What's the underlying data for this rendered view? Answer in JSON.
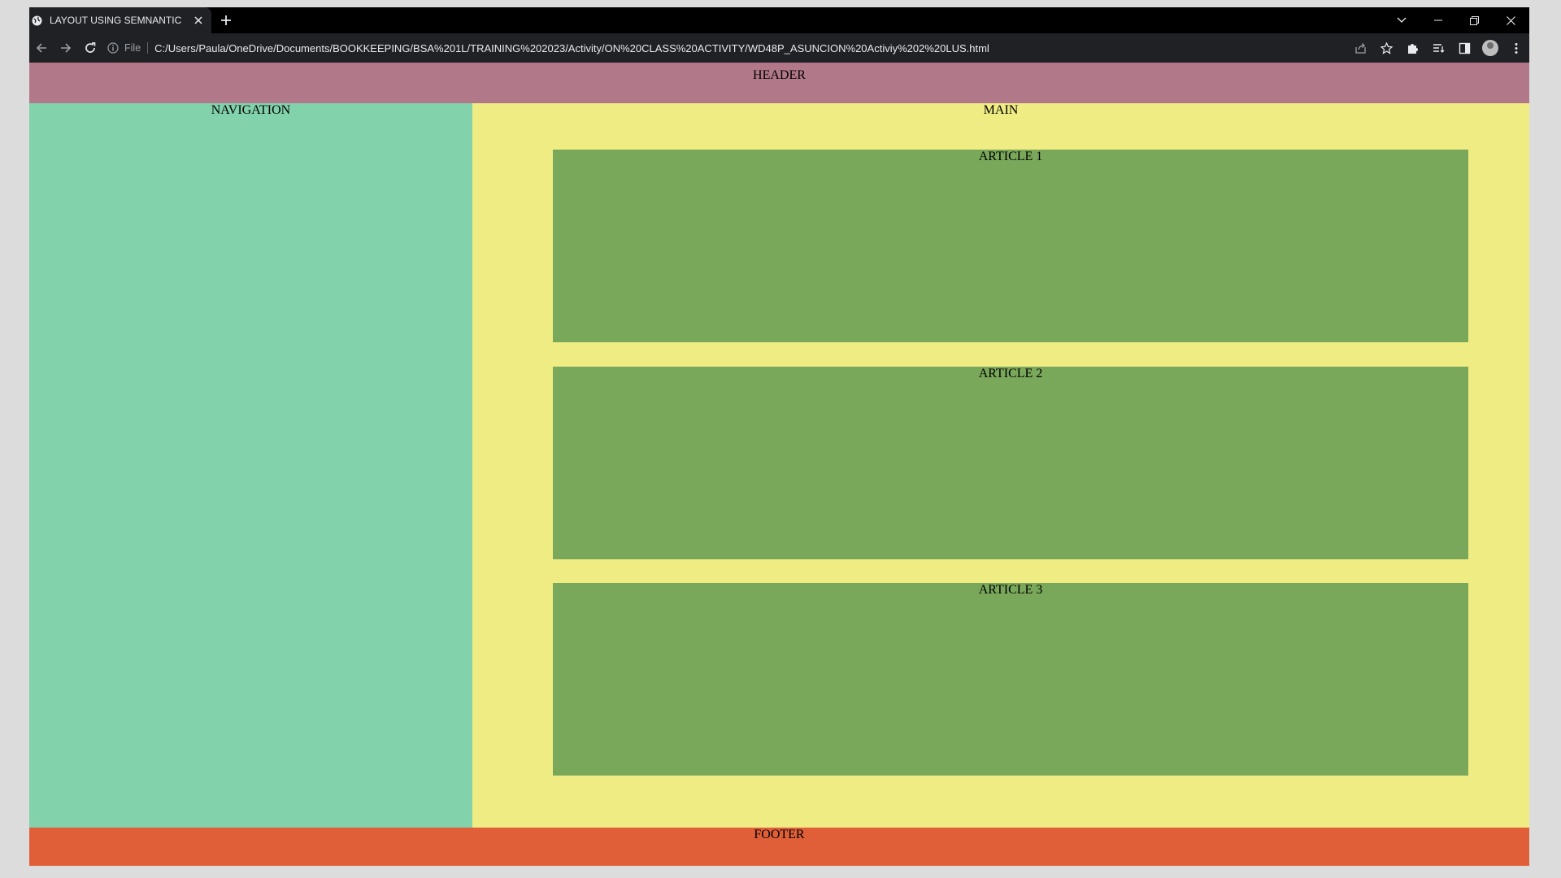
{
  "browser": {
    "tab_title": "LAYOUT USING SEMNANTIC",
    "address_scheme": "File",
    "address_url": "C:/Users/Paula/OneDrive/Documents/BOOKKEEPING/BSA%201L/TRAINING%202023/Activity/ON%20CLASS%20ACTIVITY/WD48P_ASUNCION%20Activiy%202%20LUS.html"
  },
  "page": {
    "header": "HEADER",
    "navigation": "NAVIGATION",
    "main": "MAIN",
    "articles": [
      {
        "label": "ARTICLE 1"
      },
      {
        "label": "ARTICLE 2"
      },
      {
        "label": "ARTICLE 3"
      }
    ],
    "footer": "FOOTER"
  },
  "colors": {
    "header": "#b1788a",
    "navigation": "#82d2ac",
    "main": "#efec84",
    "article": "#7aa85b",
    "footer": "#e05f38"
  }
}
